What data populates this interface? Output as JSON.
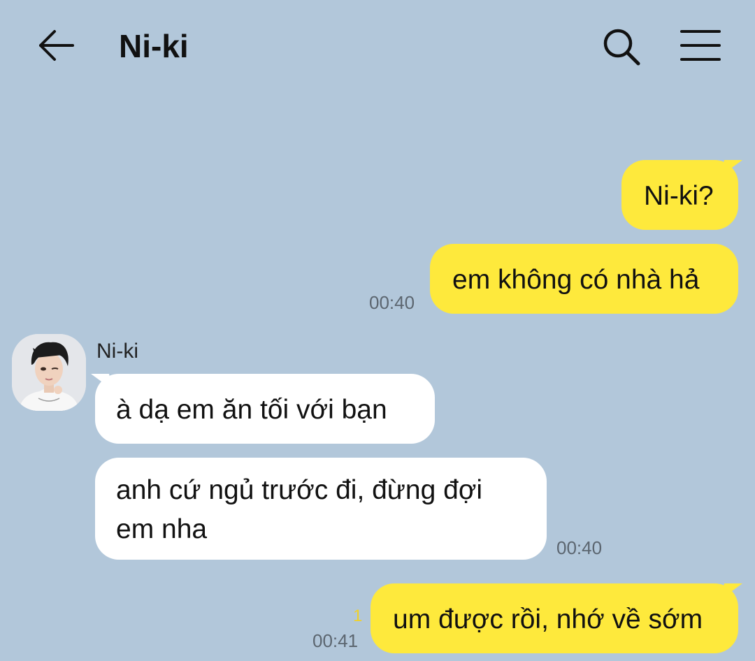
{
  "header": {
    "title": "Ni-ki",
    "back_icon": "arrow-left-icon",
    "search_icon": "search-icon",
    "menu_icon": "hamburger-menu-icon"
  },
  "colors": {
    "background": "#b2c7da",
    "my_bubble": "#fee93c",
    "their_bubble": "#ffffff",
    "timestamp": "#5c6670",
    "unread_count": "#f0d12a"
  },
  "messages": [
    {
      "from": "me",
      "text": "Ni-ki?"
    },
    {
      "from": "me",
      "text": "em không có nhà hả",
      "time": "00:40"
    },
    {
      "from": "them",
      "sender": "Ni-ki",
      "text": "à dạ em ăn tối với bạn"
    },
    {
      "from": "them",
      "text_line1": "anh cứ ngủ trước đi, đừng đợi",
      "text_line2": "em nha",
      "time": "00:40"
    },
    {
      "from": "me",
      "text": "um được rồi, nhớ về sớm",
      "time": "00:41",
      "unread": "1"
    }
  ]
}
